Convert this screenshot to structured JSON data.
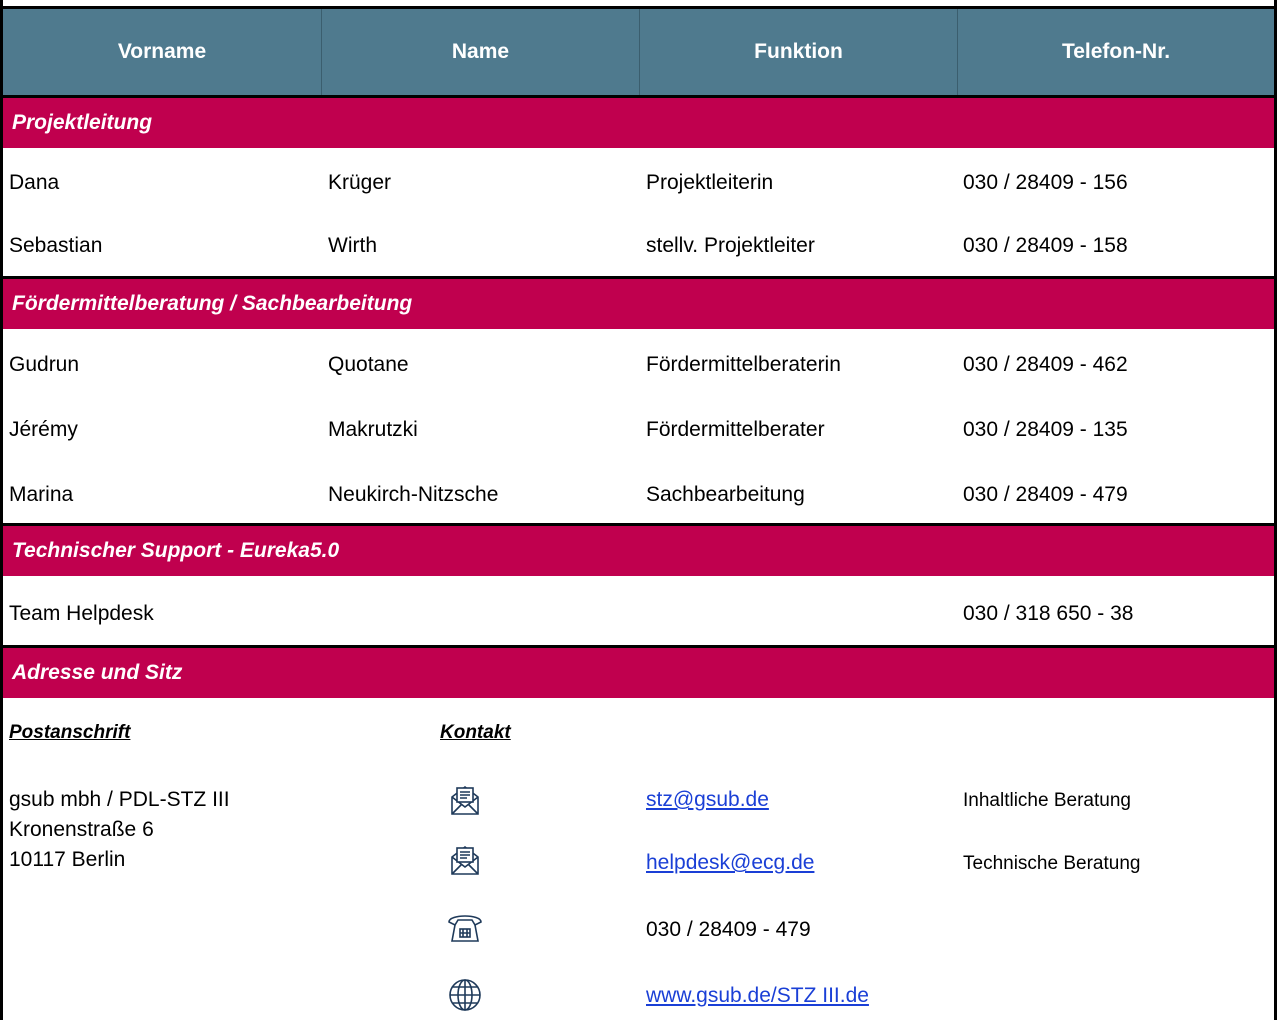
{
  "table": {
    "headers": [
      "Vorname",
      "Name",
      "Funktion",
      "Telefon-Nr."
    ]
  },
  "sections": {
    "projektleitung": {
      "title": "Projektleitung",
      "rows": [
        {
          "vorname": "Dana",
          "name": "Krüger",
          "funktion": "Projektleiterin",
          "telefon": "030 / 28409 - 156"
        },
        {
          "vorname": "Sebastian",
          "name": "Wirth",
          "funktion": "stellv. Projektleiter",
          "telefon": "030 / 28409 - 158"
        }
      ]
    },
    "foerdermittel": {
      "title": "Fördermittelberatung / Sachbearbeitung",
      "rows": [
        {
          "vorname": "Gudrun",
          "name": "Quotane",
          "funktion": "Fördermittelberaterin",
          "telefon": "030 / 28409 - 462"
        },
        {
          "vorname": "Jérémy",
          "name": "Makrutzki",
          "funktion": "Fördermittelberater",
          "telefon": "030 / 28409 - 135"
        },
        {
          "vorname": "Marina",
          "name": "Neukirch-Nitzsche",
          "funktion": "Sachbearbeitung",
          "telefon": "030 / 28409 - 479"
        }
      ]
    },
    "support": {
      "title": "Technischer Support - Eureka5.0",
      "rows": [
        {
          "vorname": "Team Helpdesk",
          "name": "",
          "funktion": "",
          "telefon": "030 / 318 650 - 38"
        }
      ]
    },
    "adresse": {
      "title": "Adresse und Sitz"
    }
  },
  "address": {
    "postanschrift_label": "Postanschrift",
    "kontakt_label": "Kontakt",
    "lines": [
      "gsub mbh / PDL-STZ III",
      "Kronenstraße 6",
      "10117 Berlin"
    ]
  },
  "contact": {
    "email1": "stz@gsub.de",
    "email1_desc": "Inhaltliche Beratung",
    "email2": "helpdesk@ecg.de",
    "email2_desc": "Technische Beratung",
    "phone": "030 / 28409 - 479",
    "website": "www.gsub.de/STZ III.de"
  },
  "icons": {
    "email": "envelope-icon",
    "phone": "telephone-icon",
    "web": "globe-icon"
  },
  "colors": {
    "header_bg": "#4f7a8e",
    "section_bg": "#c0004e",
    "link": "#1a3fd6"
  }
}
